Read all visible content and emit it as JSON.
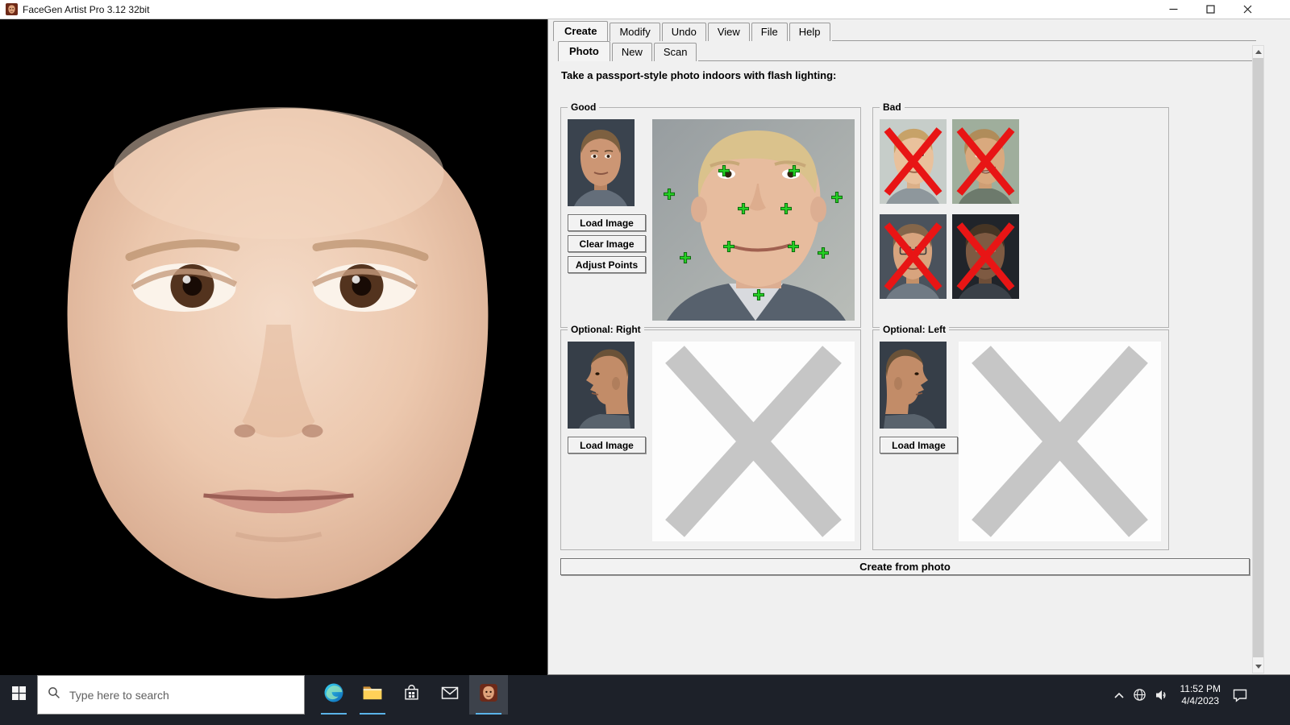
{
  "window": {
    "title": "FaceGen Artist Pro 3.12 32bit"
  },
  "menu_tabs": [
    {
      "label": "Create",
      "selected": true
    },
    {
      "label": "Modify",
      "selected": false
    },
    {
      "label": "Undo",
      "selected": false
    },
    {
      "label": "View",
      "selected": false
    },
    {
      "label": "File",
      "selected": false
    },
    {
      "label": "Help",
      "selected": false
    }
  ],
  "photo_tabs": [
    {
      "label": "Photo",
      "selected": true
    },
    {
      "label": "New",
      "selected": false
    },
    {
      "label": "Scan",
      "selected": false
    }
  ],
  "instruction": "Take a passport-style photo indoors with flash lighting:",
  "good_group": {
    "title": "Good",
    "load_button": "Load Image",
    "clear_button": "Clear Image",
    "adjust_button": "Adjust Points"
  },
  "bad_group": {
    "title": "Bad"
  },
  "optional_right_group": {
    "title": "Optional: Right",
    "load_button": "Load Image"
  },
  "optional_left_group": {
    "title": "Optional: Left",
    "load_button": "Load Image"
  },
  "create_button": "Create from photo",
  "taskbar": {
    "search_placeholder": "Type here to search",
    "clock": {
      "time": "11:52 PM",
      "date": "4/4/2023"
    }
  },
  "colors": {
    "panel_bg": "#f0f0f0",
    "taskbar_bg": "#1d2129",
    "marker_green": "#25d025",
    "bad_cross_red": "#e81515",
    "placeholder_gray": "#c6c6c6"
  }
}
